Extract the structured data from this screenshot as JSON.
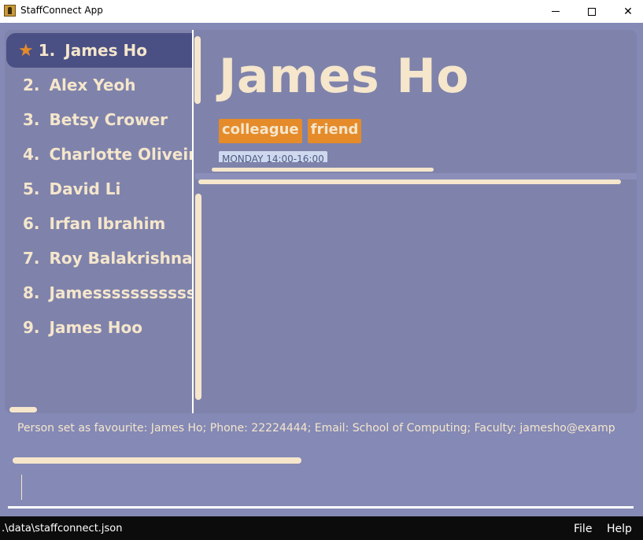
{
  "window": {
    "title": "StaffConnect App",
    "minimize_glyph": "",
    "close_glyph": "✕"
  },
  "person_list": [
    {
      "index": "1.",
      "name": "James Ho",
      "favourite": true
    },
    {
      "index": "2.",
      "name": "Alex Yeoh",
      "favourite": false
    },
    {
      "index": "3.",
      "name": "Betsy Crower",
      "favourite": false
    },
    {
      "index": "4.",
      "name": "Charlotte Oliveiro",
      "favourite": false
    },
    {
      "index": "5.",
      "name": "David Li",
      "favourite": false
    },
    {
      "index": "6.",
      "name": "Irfan Ibrahim",
      "favourite": false
    },
    {
      "index": "7.",
      "name": "Roy Balakrishnan",
      "favourite": false
    },
    {
      "index": "8.",
      "name": "Jamessssssssssssss",
      "favourite": false
    },
    {
      "index": "9.",
      "name": "James Hoo",
      "favourite": false
    }
  ],
  "favourite_icon": "★",
  "detail": {
    "name": "James Ho",
    "tags": [
      "colleague",
      "friend"
    ],
    "availability": "MONDAY 14:00-16:00"
  },
  "result": {
    "message": "Person set as favourite: James Ho; Phone: 22224444; Email: School of Computing; Faculty: jamesho@examp"
  },
  "command": {
    "value": ""
  },
  "status": {
    "path": ".\\data\\staffconnect.json"
  },
  "menu": {
    "file": "File",
    "help": "Help"
  },
  "colors": {
    "background": "#8489b5",
    "panel": "#7f83ab",
    "selected": "#4a5084",
    "text": "#f5e6cc",
    "tag": "#e58b2a",
    "statusbar": "#0c0c0c"
  }
}
